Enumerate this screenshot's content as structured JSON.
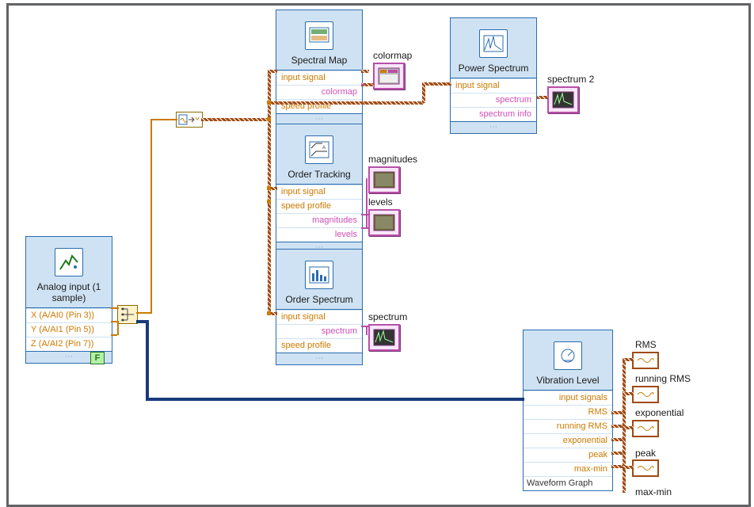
{
  "analog": {
    "title": "Analog input (1 sample)",
    "rows": [
      "X (A/AI0 (Pin 3))",
      "Y (A/AI1 (Pin 5))",
      "Z (A/AI2 (Pin 7))"
    ]
  },
  "spectralMap": {
    "title": "Spectral Map",
    "rows": [
      "input signal",
      "colormap",
      "speed profile"
    ],
    "ind": "colormap"
  },
  "powerSpectrum": {
    "title": "Power Spectrum",
    "rows": [
      "input signal",
      "spectrum",
      "spectrum info"
    ],
    "ind": "spectrum 2"
  },
  "orderTracking": {
    "title": "Order Tracking",
    "rows": [
      "input signal",
      "speed profile",
      "magnitudes",
      "levels"
    ],
    "ind1": "magnitudes",
    "ind2": "levels"
  },
  "orderSpectrum": {
    "title": "Order Spectrum",
    "rows": [
      "input signal",
      "spectrum",
      "speed profile"
    ],
    "ind": "spectrum"
  },
  "vibration": {
    "title": "Vibration Level",
    "rows": [
      "input signals",
      "RMS",
      "running RMS",
      "exponential",
      "peak",
      "max-min"
    ],
    "foot": "Waveform Graph"
  },
  "rmsLabels": {
    "rms": "RMS",
    "running": "running RMS",
    "exp": "exponential",
    "peak": "peak",
    "maxmin": "max-min"
  },
  "F": "F"
}
